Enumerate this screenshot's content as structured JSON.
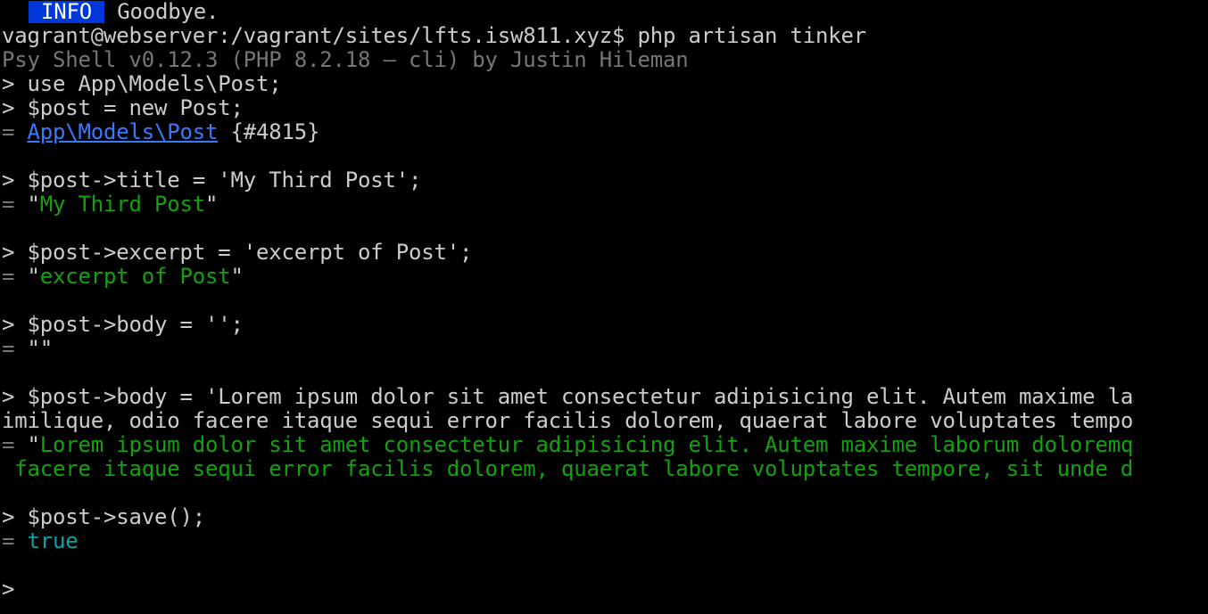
{
  "terminal": {
    "info_badge": "INFO",
    "goodbye": " Goodbye.",
    "prompt_cmd": "vagrant@webserver:/vagrant/sites/lfts.isw811.xyz$ php artisan tinker",
    "psy_banner": "Psy Shell v0.12.3 (PHP 8.2.18 — cli) by Justin Hileman",
    "l_use": "> use App\\Models\\Post;",
    "l_new": "> $post = new Post;",
    "eq": "= ",
    "model_link": "App\\Models\\Post",
    "model_id": " {#4815}",
    "l_title": "> $post->title = 'My Third Post';",
    "title_result": "My Third Post",
    "l_excerpt": "> $post->excerpt = 'excerpt of Post';",
    "excerpt_result": "excerpt of Post",
    "l_body_empty": "> $post->body = '';",
    "body_empty_result": "\"\"",
    "l_body_1": "> $post->body = 'Lorem ipsum dolor sit amet consectetur adipisicing elit. Autem maxime la",
    "l_body_2": "imilique, odio facere itaque sequi error facilis dolorem, quaerat labore voluptates tempo",
    "body_result_1": "Lorem ipsum dolor sit amet consectetur adipisicing elit. Autem maxime laborum doloremq",
    "body_result_2": " facere itaque sequi error facilis dolorem, quaerat labore voluptates tempore, sit unde d",
    "l_save": "> $post->save();",
    "save_result": "true",
    "final_prompt": ">",
    "quote": "\""
  },
  "colors": {
    "background": "#000000",
    "text": "#cccccc",
    "info_bg": "#0037da",
    "string_green": "#13a10e",
    "bool_cyan": "#0aa4a4",
    "link_blue": "#3b78ff",
    "dim_gray": "#767676"
  }
}
